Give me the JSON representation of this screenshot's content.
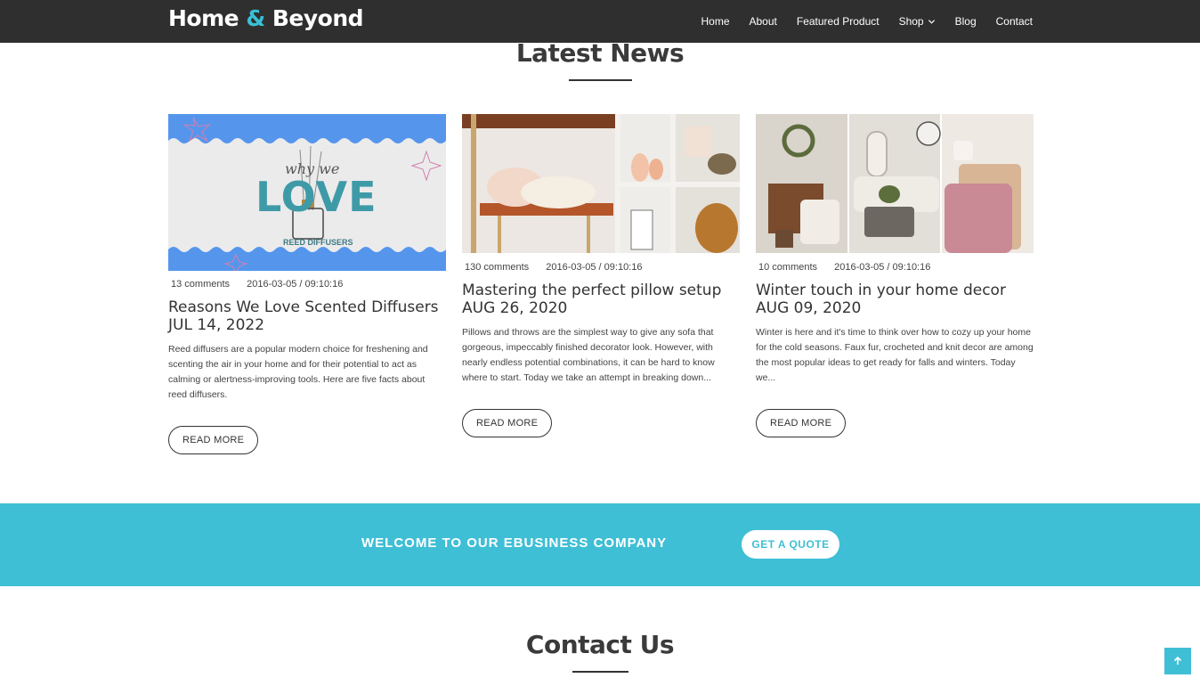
{
  "header": {
    "logo_part1": "Home",
    "logo_amp": "&",
    "logo_part2": "Beyond",
    "nav": [
      "Home",
      "About",
      "Featured Product",
      "Shop",
      "Blog",
      "Contact"
    ]
  },
  "news": {
    "title": "Latest News",
    "cards": [
      {
        "image_text_script": "why we",
        "image_text_big": "LOVE",
        "image_text_small": "REED DIFFUSERS",
        "comments": "13 comments",
        "datetime": "2016-03-05 / 09:10:16",
        "title": "Reasons We Love Scented Diffusers",
        "date": "JUL 14, 2022",
        "text": "Reed diffusers are a popular modern choice for freshening and scenting the air in your home and for their potential to act as calming or alertness-improving tools. Here are five facts about reed diffusers.",
        "button": "READ MORE"
      },
      {
        "comments": "130 comments",
        "datetime": "2016-03-05 / 09:10:16",
        "title": "Mastering the perfect pillow setup",
        "date": "AUG 26, 2020",
        "text": "Pillows and throws are the simplest way to give any sofa that gorgeous, impeccably finished decorator look. However, with nearly endless potential combinations, it can be hard to know where to start. Today we take an attempt in breaking down...",
        "button": "READ MORE"
      },
      {
        "comments": "10 comments",
        "datetime": "2016-03-05 / 09:10:16",
        "title": "Winter touch in your home decor",
        "date": "AUG 09, 2020",
        "text": "Winter is here and it's time to think over how to cozy up your home for the cold seasons. Faux fur, crocheted and knit decor are among the most popular ideas to get ready for falls and winters. Today we...",
        "button": "READ MORE"
      }
    ]
  },
  "banner": {
    "text": "WELCOME TO OUR EBUSINESS COMPANY",
    "button": "GET A QUOTE"
  },
  "contact": {
    "title": "Contact Us"
  },
  "colors": {
    "accent": "#3fbfd5",
    "header_bg": "#2f2f2f"
  },
  "icons": {
    "shop_dropdown": "chevron-down-icon",
    "scroll_top": "arrow-up-icon"
  }
}
